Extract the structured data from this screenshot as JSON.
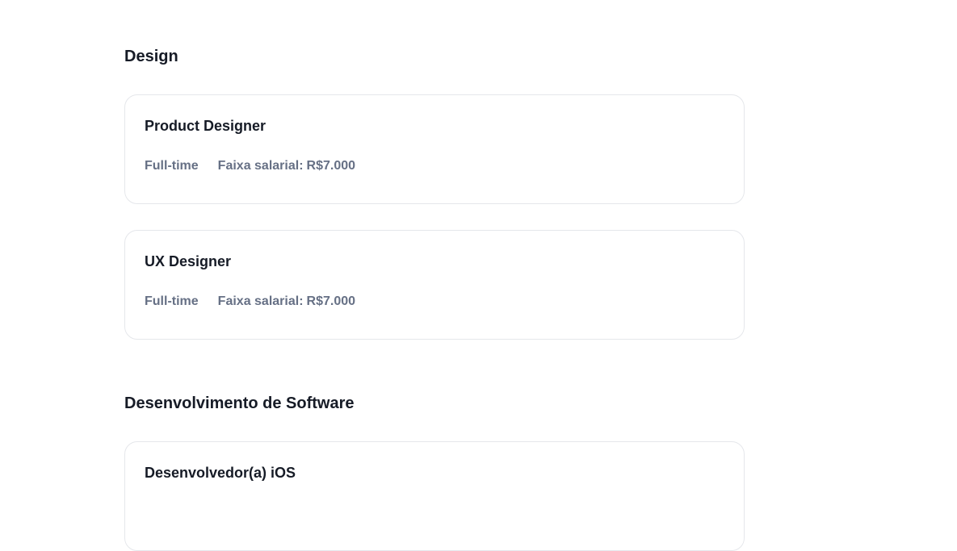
{
  "sections": [
    {
      "title": "Design",
      "jobs": [
        {
          "title": "Product Designer",
          "type": "Full-time",
          "salary_label": "Faixa salarial:",
          "salary_value": "R$7.000"
        },
        {
          "title": "UX Designer",
          "type": "Full-time",
          "salary_label": "Faixa salarial:",
          "salary_value": "R$7.000"
        }
      ]
    },
    {
      "title": "Desenvolvimento de Software",
      "jobs": [
        {
          "title": "Desenvolvedor(a) iOS"
        }
      ]
    }
  ]
}
